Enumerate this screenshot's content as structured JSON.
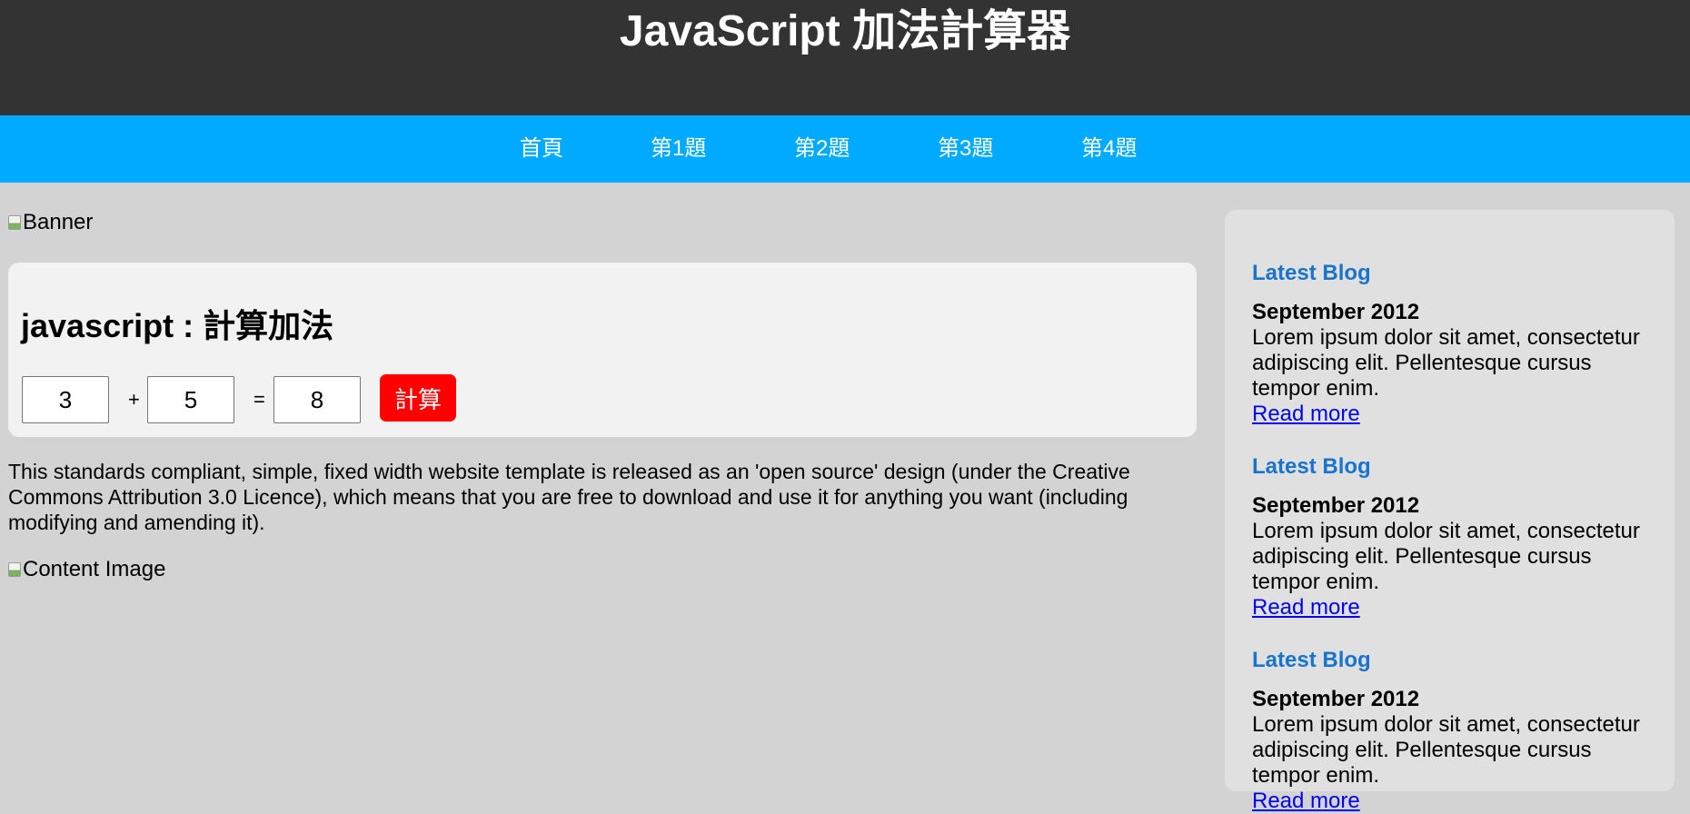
{
  "header": {
    "title": "JavaScript 加法計算器"
  },
  "nav": {
    "items": [
      {
        "label": "首頁"
      },
      {
        "label": "第1題"
      },
      {
        "label": "第2題"
      },
      {
        "label": "第3題"
      },
      {
        "label": "第4題"
      }
    ]
  },
  "banner": {
    "alt": "Banner"
  },
  "calculator": {
    "title": "javascript : 計算加法",
    "operand1": "3",
    "plus": "+",
    "operand2": "5",
    "equals": "=",
    "result": "8",
    "button_label": "計算",
    "button_color": "#ff0000"
  },
  "content": {
    "paragraph": "This standards compliant, simple, fixed width website template is released as an 'open source' design (under the Creative Commons Attribution 3.0 Licence), which means that you are free to download and use it for anything you want (including modifying and amending it).",
    "image_alt": "Content Image"
  },
  "sidebar": {
    "blogs": [
      {
        "heading": "Latest Blog",
        "date": "September 2012",
        "text": "Lorem ipsum dolor sit amet, consectetur adipiscing elit. Pellentesque cursus tempor enim.",
        "link": "Read more"
      },
      {
        "heading": "Latest Blog",
        "date": "September 2012",
        "text": "Lorem ipsum dolor sit amet, consectetur adipiscing elit. Pellentesque cursus tempor enim.",
        "link": "Read more"
      },
      {
        "heading": "Latest Blog",
        "date": "September 2012",
        "text": "Lorem ipsum dolor sit amet, consectetur adipiscing elit. Pellentesque cursus tempor enim.",
        "link": "Read more"
      }
    ]
  },
  "colors": {
    "header_bg": "#333333",
    "nav_bg": "#00aaff",
    "page_bg": "#d3d3d3",
    "panel_bg": "#f2f2f2",
    "sidebar_bg": "#e0e0e0",
    "blog_heading": "#1874cd",
    "link": "#0000ee"
  }
}
